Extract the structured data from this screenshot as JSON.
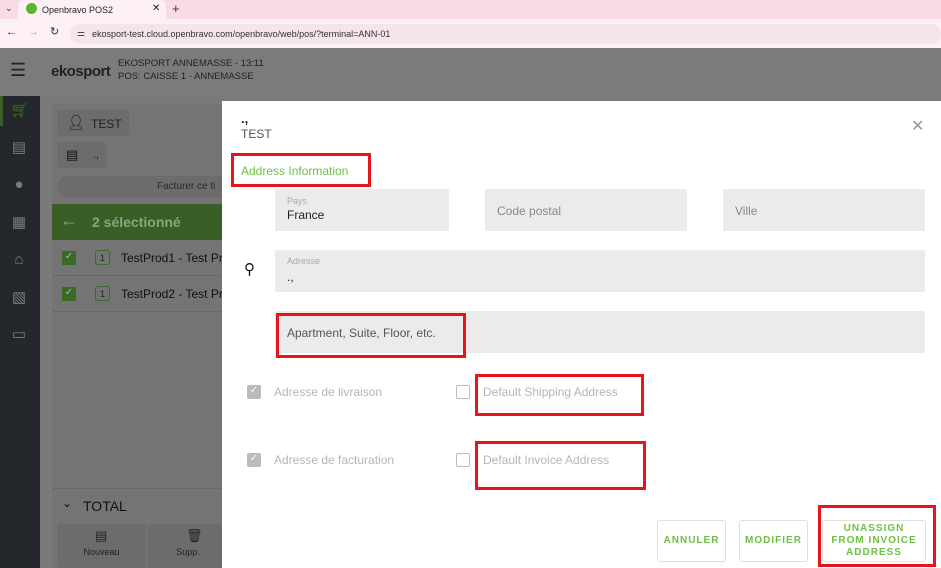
{
  "browser": {
    "tab_title": "Openbravo POS2",
    "url": "ekosport-test.cloud.openbravo.com/openbravo/web/pos/?terminal=ANN-01"
  },
  "header": {
    "logo": "ekosport",
    "store_line": "EKOSPORT ANNEMASSE - 13:11",
    "pos_line": "POS: CAISSE 1 - ANNEMASSE"
  },
  "ticket": {
    "customer": "TEST",
    "address": ".,",
    "invoice_button": "Facturer ce ti",
    "selected_label": "2 sélectionné",
    "lines": [
      {
        "qty": "1",
        "name": "TestProd1 - Test Pr"
      },
      {
        "qty": "1",
        "name": "TestProd2 - Test Pr"
      }
    ],
    "total_label": "TOTAL",
    "new_label": "Nouveau",
    "delete_label": "Supp."
  },
  "dialog": {
    "title_line1": ".,",
    "title_line2": "TEST",
    "section_title": "Address Information",
    "country_label": "Pays",
    "country_value": "France",
    "postal_placeholder": "Code postal",
    "city_placeholder": "Ville",
    "address_label": "Adresse",
    "address_value": ".,",
    "apartment_placeholder": "Apartment, Suite, Floor, etc.",
    "shipping_label": "Adresse de livraison",
    "invoice_label": "Adresse de facturation",
    "default_shipping_label": "Default Shipping Address",
    "default_invoice_label": "Default Invoice Address",
    "cancel_button": "ANNULER",
    "modify_button": "MODIFIER",
    "unassign_button": "UNASSIGN FROM INVOICE ADDRESS"
  },
  "colors": {
    "accent": "#6fbf44",
    "highlight": "#e8141c",
    "selection_bar": "#3a5f26"
  }
}
